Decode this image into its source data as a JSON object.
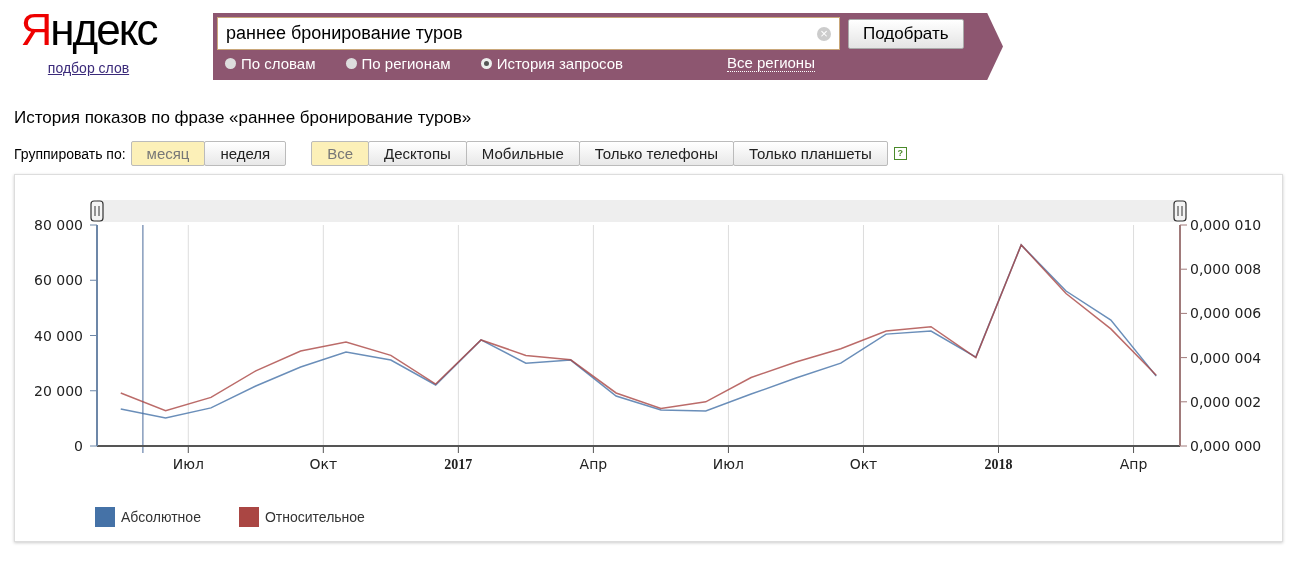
{
  "header": {
    "logo": "Яндекс",
    "logo_link": "подбор слов"
  },
  "search": {
    "value": "раннее бронирование туров",
    "clear": "×",
    "button": "Подобрать",
    "modes": [
      {
        "label": "По словам",
        "selected": false
      },
      {
        "label": "По регионам",
        "selected": false
      },
      {
        "label": "История запросов",
        "selected": true
      }
    ],
    "regions_link": "Все регионы"
  },
  "title": "История показов по фразе «раннее бронирование туров»",
  "grouping": {
    "label": "Группировать по:",
    "options": [
      {
        "label": "месяц",
        "selected": true
      },
      {
        "label": "неделя",
        "selected": false
      }
    ]
  },
  "devices": [
    {
      "label": "Все",
      "selected": true
    },
    {
      "label": "Десктопы",
      "selected": false
    },
    {
      "label": "Мобильные",
      "selected": false
    },
    {
      "label": "Только телефоны",
      "selected": false
    },
    {
      "label": "Только планшеты",
      "selected": false
    }
  ],
  "help": "?",
  "chart": {
    "chart_data": {
      "type": "line",
      "x": [
        2016.375,
        2016.458,
        2016.542,
        2016.625,
        2016.708,
        2016.792,
        2016.875,
        2016.958,
        2017.042,
        2017.125,
        2017.208,
        2017.292,
        2017.375,
        2017.458,
        2017.542,
        2017.625,
        2017.708,
        2017.792,
        2017.875,
        2017.958,
        2018.042,
        2018.125,
        2018.208,
        2018.292
      ],
      "xlim": [
        2016.331,
        2018.336
      ],
      "xticks": [
        {
          "value": 2016.5,
          "label": "Июл"
        },
        {
          "value": 2016.75,
          "label": "Окт"
        },
        2017,
        {
          "value": 2017.25,
          "label": "Апр"
        },
        {
          "value": 2017.5,
          "label": "Июл"
        },
        {
          "value": 2017.75,
          "label": "Окт"
        },
        2018,
        {
          "value": 2018.25,
          "label": "Апр"
        }
      ],
      "grid": "x",
      "ref_lines": [
        {
          "axis": "x",
          "value": 2016.416
        }
      ],
      "ylim": [
        0,
        80000
      ],
      "yticks": [
        {
          "value": 0,
          "label": "0"
        },
        {
          "value": 20000,
          "label": "20 000"
        },
        {
          "value": 40000,
          "label": "40 000"
        },
        {
          "value": 60000,
          "label": "60 000"
        },
        {
          "value": 80000,
          "label": "80 000"
        }
      ],
      "y2lim": [
        0,
        1e-05
      ],
      "y2ticks": [
        {
          "value": 0,
          "label": "0,000 000"
        },
        {
          "value": 2e-06,
          "label": "0,000 002"
        },
        {
          "value": 4e-06,
          "label": "0,000 004"
        },
        {
          "value": 6e-06,
          "label": "0,000 006"
        },
        {
          "value": 8e-06,
          "label": "0,000 008"
        },
        {
          "value": 1e-05,
          "label": "0,000 010"
        }
      ],
      "series": [
        {
          "name": "Абсолютное",
          "color": "#4572a7",
          "values": [
            13400,
            10100,
            13800,
            21700,
            28600,
            34000,
            31100,
            22100,
            38400,
            30000,
            31100,
            18100,
            13000,
            12700,
            18800,
            24600,
            30000,
            40500,
            41600,
            32200,
            72800,
            56100,
            45600,
            25300
          ]
        },
        {
          "name": "Относительное",
          "color": "#aa4643",
          "axis": "y2",
          "values": [
            2.4e-06,
            1.6e-06,
            2.2e-06,
            3.4e-06,
            4.3e-06,
            4.7e-06,
            4.1e-06,
            2.8e-06,
            4.8e-06,
            4.1e-06,
            3.9e-06,
            2.4e-06,
            1.7e-06,
            2e-06,
            3.1e-06,
            3.8e-06,
            4.4e-06,
            5.2e-06,
            5.4e-06,
            4e-06,
            9.1e-06,
            6.9e-06,
            5.3e-06,
            3.2e-06
          ]
        }
      ]
    }
  }
}
